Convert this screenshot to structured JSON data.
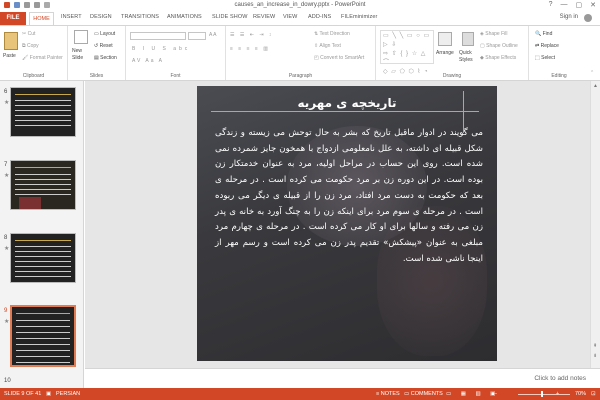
{
  "window": {
    "title": "causes_an_increase_in_dowry.pptx - PowerPoint",
    "controls": [
      "?",
      "—",
      "▢",
      "✕"
    ]
  },
  "ribbon_tabs": {
    "file": "FILE",
    "home": "HOME",
    "others": [
      "INSERT",
      "DESIGN",
      "TRANSITIONS",
      "ANIMATIONS",
      "SLIDE SHOW",
      "REVIEW",
      "VIEW",
      "ADD-INS",
      "FILEminimizer"
    ],
    "signin": "Sign in"
  },
  "ribbon": {
    "clipboard": {
      "label": "Clipboard",
      "paste": "Paste",
      "cut": "Cut",
      "copy": "Copy",
      "format_painter": "Format Painter"
    },
    "slides": {
      "label": "Slides",
      "new_slide": "New Slide",
      "layout": "Layout",
      "reset": "Reset",
      "section": "Section"
    },
    "font": {
      "label": "Font"
    },
    "paragraph": {
      "label": "Paragraph",
      "text_direction": "Text Direction",
      "align_text": "Align Text",
      "smartart": "Convert to SmartArt"
    },
    "drawing": {
      "label": "Drawing",
      "arrange": "Arrange",
      "quick_styles": "Quick Styles",
      "shape_fill": "Shape Fill",
      "shape_outline": "Shape Outline",
      "shape_effects": "Shape Effects"
    },
    "editing": {
      "label": "Editing",
      "find": "Find",
      "replace": "Replace",
      "select": "Select"
    }
  },
  "slide_panel": {
    "thumbnails": [
      {
        "number": "6",
        "star": "★"
      },
      {
        "number": "7",
        "star": "★"
      },
      {
        "number": "8",
        "star": "★"
      },
      {
        "number": "9",
        "star": "★"
      },
      {
        "number": "10",
        "star": ""
      }
    ]
  },
  "slide": {
    "title": "تاریخچه ی مهریه",
    "body": "می گویند در ادوار ماقبل تاریخ که بشر به حال توحش می زیسته و زندگی شکل قبیله ای داشته، به علل نامعلومی ازدواج با همخون جایز شمرده نمی شده است. روی این حساب در مراحل اولیه، مرد به عنوان خدمتکار زن بوده است. در این دوره زن بر مرد حکومت می کرده است . در مرحله ی بعد که حکومت به دست مرد افتاد، مرد زن را از قبیله ی دیگر می ربوده است . در مرحله ی سوم مرد برای اینکه زن را به چنگ آورد به خانه ی پدر زن می رفته و سالها برای او کار می کرده است . در مرحله ی چهارم مرد مبلغی به عنوان «پیشکش» تقدیم پدر زن می کرده است و رسم مهر از اینجا ناشی شده است."
  },
  "notes_hint": "Click to add notes",
  "status": {
    "slide_info": "SLIDE 9 OF 41",
    "language": "PERSIAN",
    "notes": "NOTES",
    "comments": "COMMENTS",
    "zoom": "70%"
  },
  "colors": {
    "accent": "#d24726",
    "gold": "#c9a84b"
  }
}
